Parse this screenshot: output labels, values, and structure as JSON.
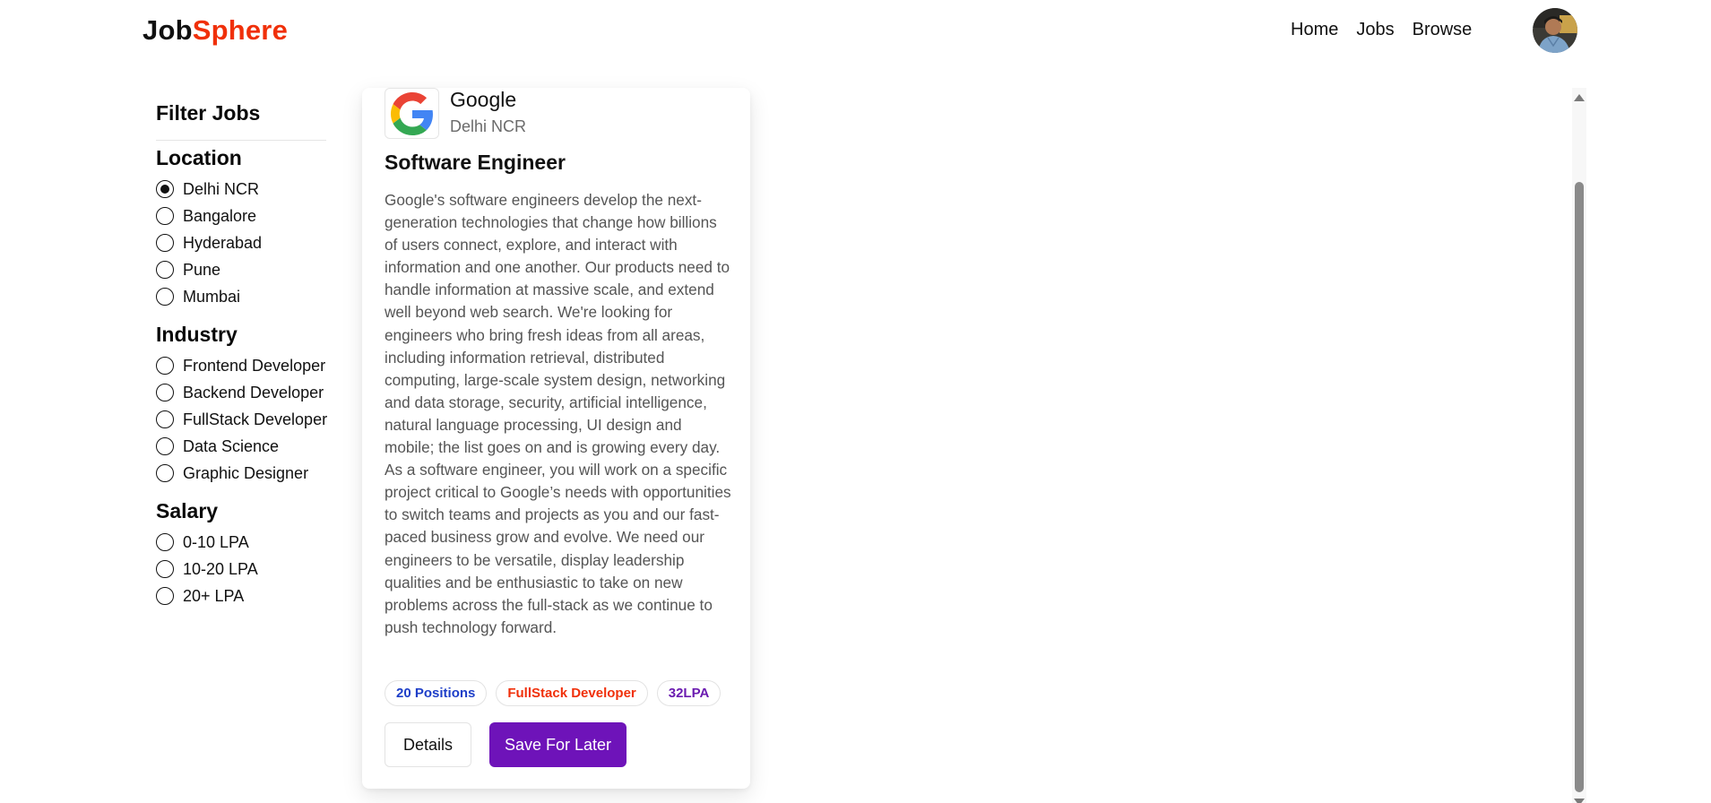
{
  "header": {
    "logo_part1": "Job",
    "logo_part2": "Sphere",
    "nav": [
      "Home",
      "Jobs",
      "Browse"
    ],
    "colors": {
      "brand": "#f0300a"
    }
  },
  "sidebar": {
    "title": "Filter Jobs",
    "groups": [
      {
        "title": "Location",
        "options": [
          "Delhi NCR",
          "Bangalore",
          "Hyderabad",
          "Pune",
          "Mumbai"
        ],
        "selected": "Delhi NCR"
      },
      {
        "title": "Industry",
        "options": [
          "Frontend Developer",
          "Backend Developer",
          "FullStack Developer",
          "Data Science",
          "Graphic Designer"
        ],
        "selected": null
      },
      {
        "title": "Salary",
        "options": [
          "0-10 LPA",
          "10-20 LPA",
          "20+ LPA"
        ],
        "selected": null
      }
    ]
  },
  "job": {
    "company": "Google",
    "location": "Delhi NCR",
    "logo_icon": "google-logo-icon",
    "title": "Software Engineer",
    "description": "Google's software engineers develop the next-generation technologies that change how billions of users connect, explore, and interact with information and one another. Our products need to handle information at massive scale, and extend well beyond web search. We're looking for engineers who bring fresh ideas from all areas, including information retrieval, distributed computing, large-scale system design, networking and data storage, security, artificial intelligence, natural language processing, UI design and mobile; the list goes on and is growing every day. As a software engineer, you will work on a specific project critical to Google’s needs with opportunities to switch teams and projects as you and our fast-paced business grow and evolve. We need our engineers to be versatile, display leadership qualities and be enthusiastic to take on new problems across the full-stack as we continue to push technology forward.",
    "badges": {
      "positions": "20 Positions",
      "job_type": "FullStack Developer",
      "salary": "32LPA"
    },
    "details_label": "Details",
    "save_label": "Save For Later",
    "colors": {
      "save_button": "#6e13b9",
      "badge_blue": "#1d3ec8",
      "badge_red": "#f0300a",
      "badge_purple": "#6b1bb0"
    }
  }
}
